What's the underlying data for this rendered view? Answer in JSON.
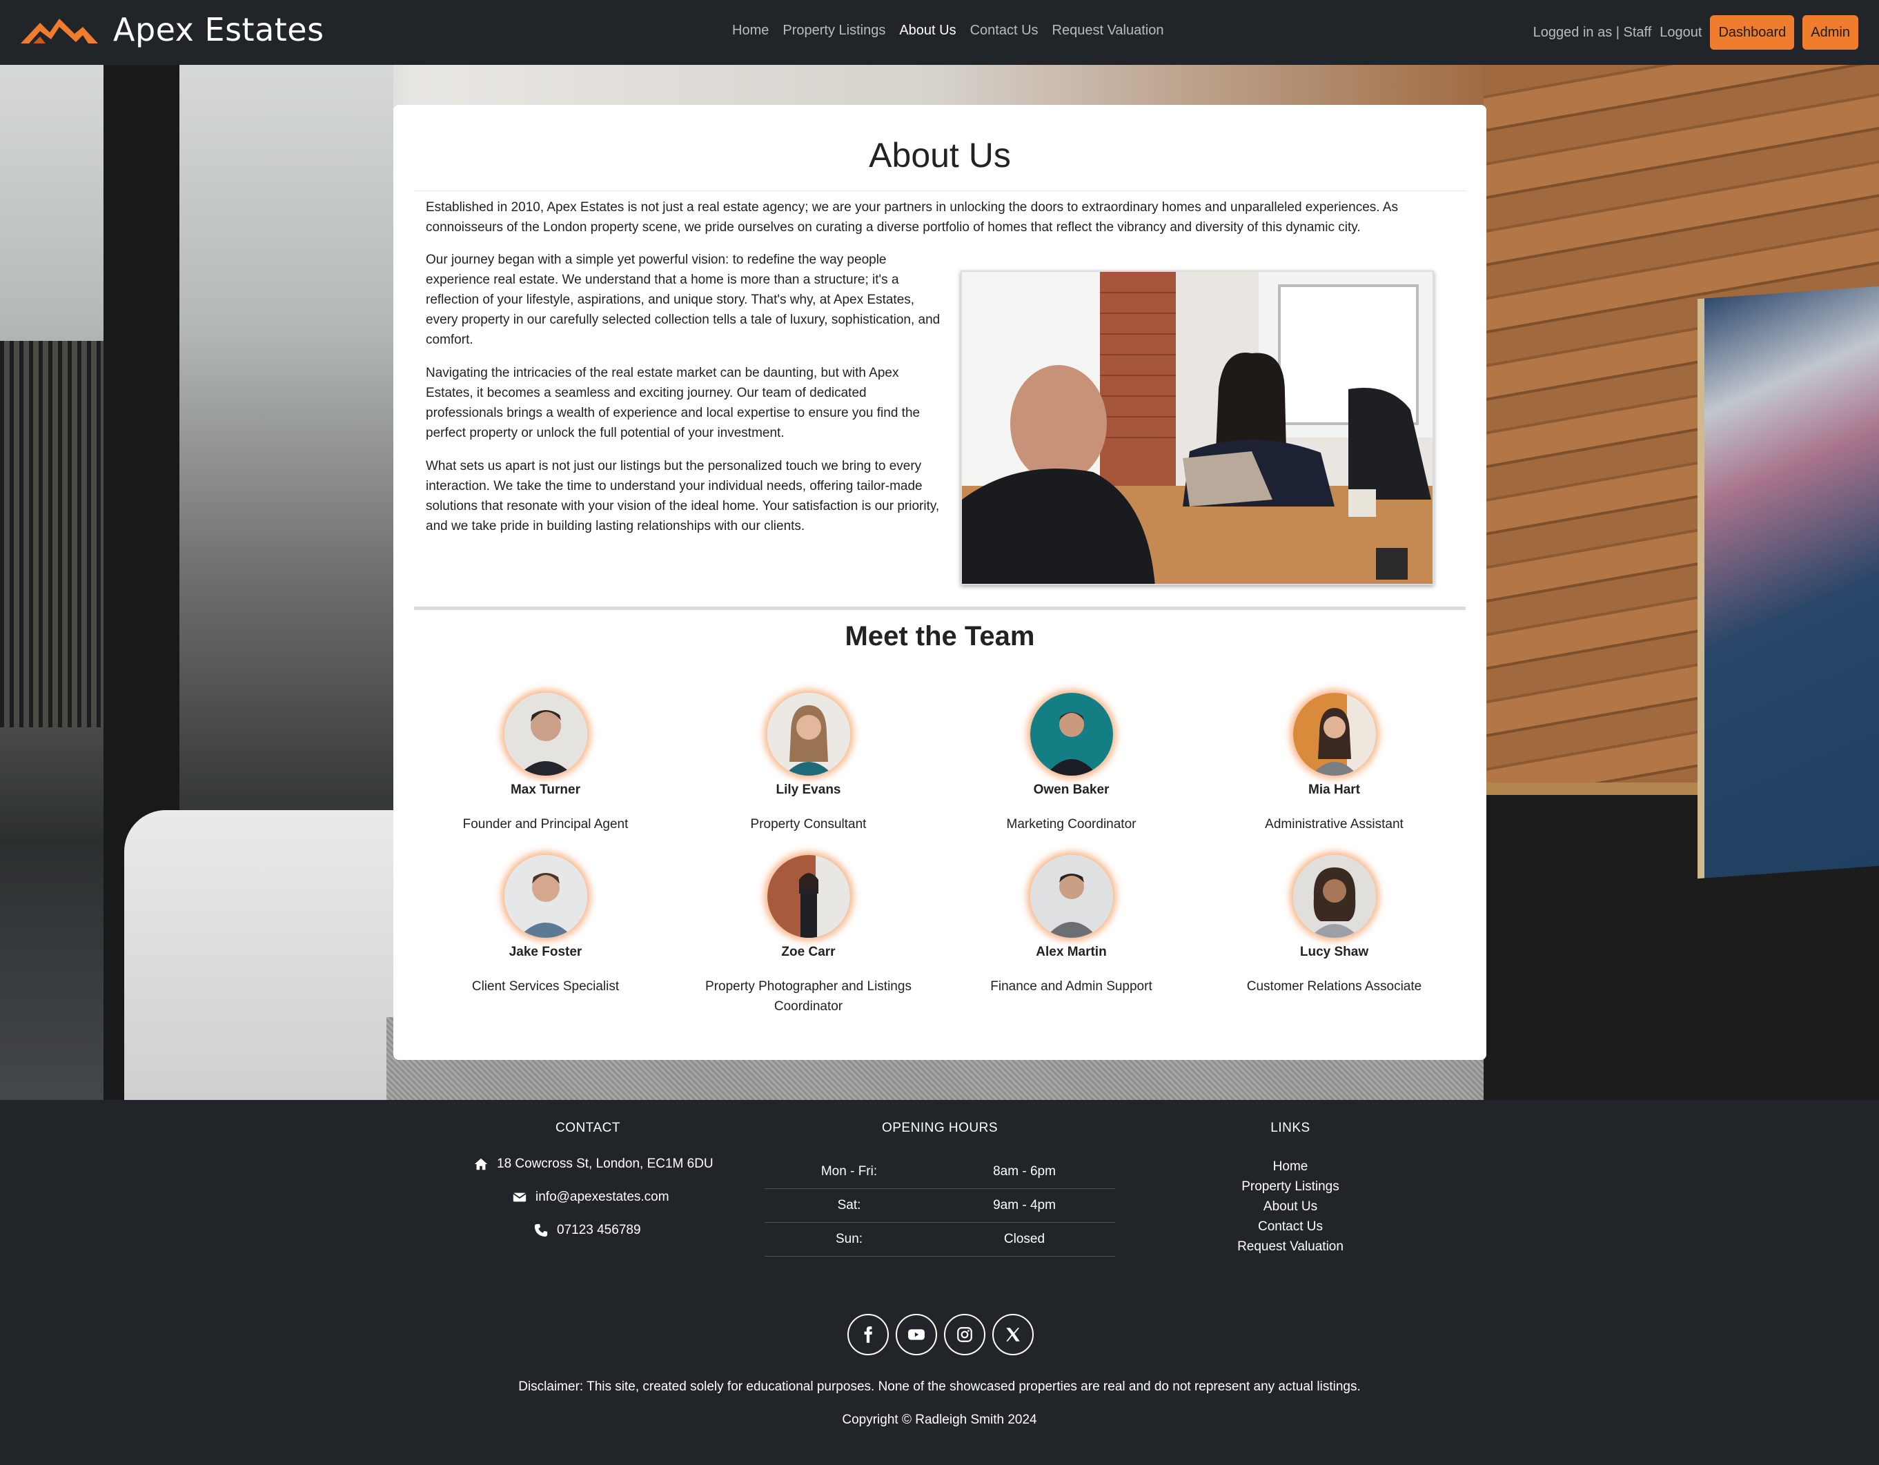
{
  "brand": {
    "name": "Apex Estates",
    "accent": "#f07c2e"
  },
  "nav": {
    "links": [
      {
        "label": "Home"
      },
      {
        "label": "Property Listings"
      },
      {
        "label": "About Us",
        "active": true
      },
      {
        "label": "Contact Us"
      },
      {
        "label": "Request Valuation"
      }
    ],
    "user_text": "Logged in as | Staff",
    "logout_label": "Logout",
    "dashboard_label": "Dashboard",
    "admin_label": "Admin"
  },
  "about": {
    "title": "About Us",
    "intro": "Established in 2010, Apex Estates is not just a real estate agency; we are your partners in unlocking the doors to extraordinary homes and unparalleled experiences. As connoisseurs of the London property scene, we pride ourselves on curating a diverse portfolio of homes that reflect the vibrancy and diversity of this dynamic city.",
    "paragraphs": [
      "Our journey began with a simple yet powerful vision: to redefine the way people experience real estate. We understand that a home is more than a structure; it's a reflection of your lifestyle, aspirations, and unique story. That's why, at Apex Estates, every property in our carefully selected collection tells a tale of luxury, sophistication, and comfort.",
      "Navigating the intricacies of the real estate market can be daunting, but with Apex Estates, it becomes a seamless and exciting journey. Our team of dedicated professionals brings a wealth of experience and local expertise to ensure you find the perfect property or unlock the full potential of your investment.",
      "What sets us apart is not just our listings but the personalized touch we bring to every interaction. We take the time to understand your individual needs, offering tailor-made solutions that resonate with your vision of the ideal home. Your satisfaction is our priority, and we take pride in building lasting relationships with our clients."
    ]
  },
  "team": {
    "title": "Meet the Team",
    "members": [
      {
        "name": "Max Turner",
        "role": "Founder and Principal Agent"
      },
      {
        "name": "Lily Evans",
        "role": "Property Consultant"
      },
      {
        "name": "Owen Baker",
        "role": "Marketing Coordinator"
      },
      {
        "name": "Mia Hart",
        "role": "Administrative Assistant"
      },
      {
        "name": "Jake Foster",
        "role": "Client Services Specialist"
      },
      {
        "name": "Zoe Carr",
        "role": "Property Photographer and Listings Coordinator"
      },
      {
        "name": "Alex Martin",
        "role": "Finance and Admin Support"
      },
      {
        "name": "Lucy Shaw",
        "role": "Customer Relations Associate"
      }
    ]
  },
  "footer": {
    "contact": {
      "heading": "CONTACT",
      "address": "18 Cowcross St, London, EC1M 6DU",
      "email": "info@apexestates.com",
      "phone": "07123 456789"
    },
    "hours": {
      "heading": "OPENING HOURS",
      "rows": [
        {
          "day": "Mon - Fri:",
          "time": "8am - 6pm"
        },
        {
          "day": "Sat:",
          "time": "9am - 4pm"
        },
        {
          "day": "Sun:",
          "time": "Closed"
        }
      ]
    },
    "links": {
      "heading": "LINKS",
      "items": [
        "Home",
        "Property Listings",
        "About Us",
        "Contact Us",
        "Request Valuation"
      ]
    },
    "socials": [
      "facebook-icon",
      "youtube-icon",
      "instagram-icon",
      "x-icon"
    ],
    "disclaimer": "Disclaimer: This site, created solely for educational purposes. None of the showcased properties are real and do not represent any actual listings.",
    "copyright": "Copyright © Radleigh Smith 2024"
  }
}
